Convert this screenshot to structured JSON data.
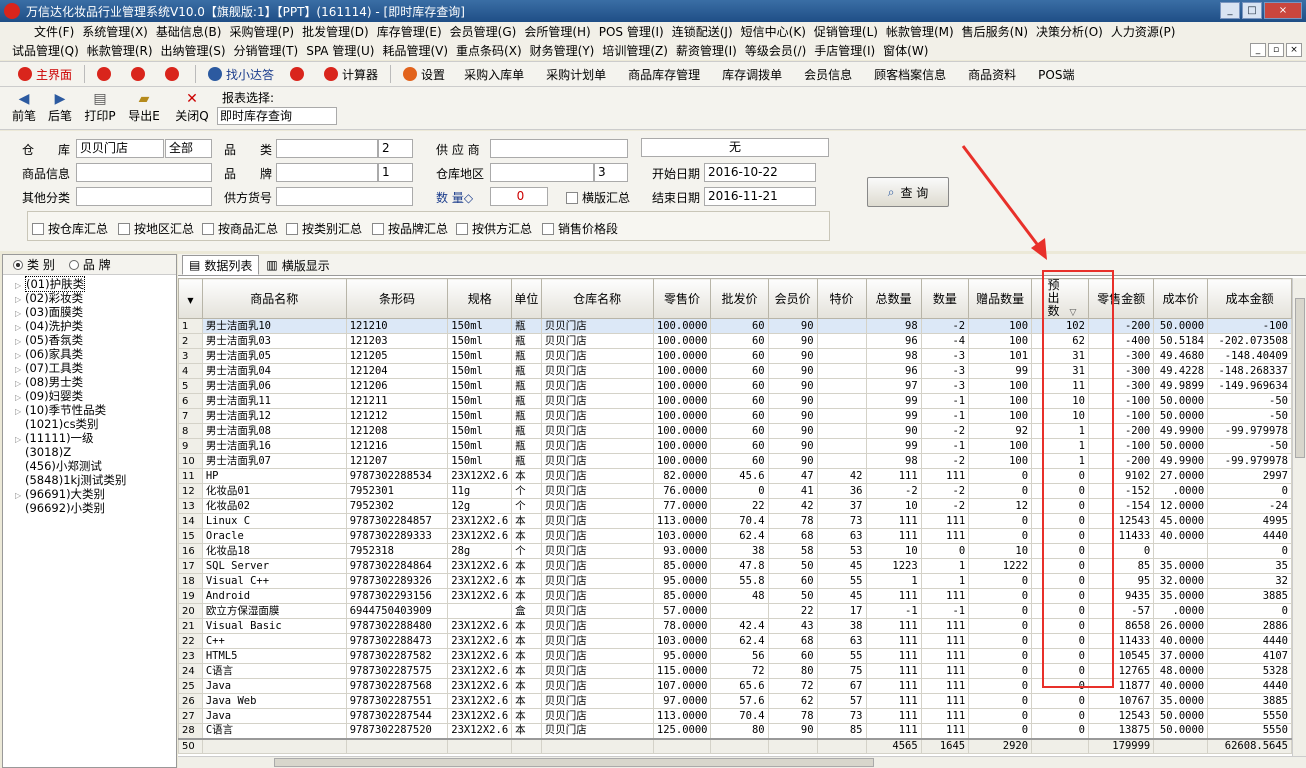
{
  "window": {
    "title": "万信达化妆品行业管理系统V10.0【旗舰版:1】【PPT】(161114) - [即时库存查询]",
    "minimize": "_",
    "restore": "□",
    "close": "×"
  },
  "menu1": [
    "文件(F)",
    "系统管理(X)",
    "基础信息(B)",
    "采购管理(P)",
    "批发管理(D)",
    "库存管理(E)",
    "会员管理(G)",
    "会所管理(H)",
    "POS 管理(I)",
    "连锁配送(J)",
    "短信中心(K)",
    "促销管理(L)",
    "帐款管理(M)",
    "售后服务(N)",
    "决策分析(O)",
    "人力资源(P)"
  ],
  "menu2": [
    "试品管理(Q)",
    "帐款管理(R)",
    "出纳管理(S)",
    "分销管理(T)",
    "SPA 管理(U)",
    "耗品管理(V)",
    "重点条码(X)",
    "财务管理(Y)",
    "培训管理(Z)",
    "薪资管理(I)",
    "等级会员(/)",
    "手店管理(I)",
    "窗体(W)"
  ],
  "toolbar": {
    "home": "主界面",
    "find": "找小达答",
    "calc": "计算器",
    "settings": "设置",
    "links": [
      "采购入库单",
      "采购计划单",
      "商品库存管理",
      "库存调拨单",
      "会员信息",
      "顾客档案信息",
      "商品资料",
      "POS端"
    ]
  },
  "actions": {
    "prev": "前笔",
    "next": "后笔",
    "print": "打印P",
    "export": "导出E",
    "close": "关闭Q",
    "report_label": "报表选择:",
    "report_value": "即时库存查询"
  },
  "filter": {
    "warehouse_label": "仓　　库",
    "warehouse_value": "贝贝门店",
    "warehouse_all": "全部",
    "category_label": "品　　类",
    "category_count": "2",
    "supplier_label": "供 应 商",
    "none_label": "无",
    "product_info_label": "商品信息",
    "brand_label": "品　　牌",
    "brand_count": "1",
    "area_label": "仓库地区",
    "area_count": "3",
    "start_date_label": "开始日期",
    "start_date": "2016-10-22",
    "other_cat_label": "其他分类",
    "supplier_code_label": "供方货号",
    "qty_label": "数 量◇",
    "qty_value": "0",
    "landscape_sum": "横版汇总",
    "end_date_label": "结束日期",
    "end_date": "2016-11-21",
    "query_button": "查 询",
    "sum_options": [
      "按仓库汇总",
      "按地区汇总",
      "按商品汇总",
      "按类别汇总",
      "按品牌汇总",
      "按供方汇总",
      "销售价格段"
    ]
  },
  "left_panel": {
    "tab_category": "类 别",
    "tab_brand": "品 牌",
    "tree": [
      {
        "label": "(01)护肤类",
        "exp": true,
        "selected": true
      },
      {
        "label": "(02)彩妆类",
        "exp": true
      },
      {
        "label": "(03)面膜类",
        "exp": true
      },
      {
        "label": "(04)洗护类",
        "exp": true
      },
      {
        "label": "(05)香氛类",
        "exp": true
      },
      {
        "label": "(06)家具类",
        "exp": true
      },
      {
        "label": "(07)工具类",
        "exp": true
      },
      {
        "label": "(08)男士类",
        "exp": true
      },
      {
        "label": "(09)妇婴类",
        "exp": true
      },
      {
        "label": "(10)季节性品类",
        "exp": true
      },
      {
        "label": "(1021)cs类别",
        "exp": false
      },
      {
        "label": "(11111)一级",
        "exp": true
      },
      {
        "label": "(3018)Z",
        "exp": false
      },
      {
        "label": "(456)小郑测试",
        "exp": false
      },
      {
        "label": "(5848)1kj测试类别",
        "exp": false
      },
      {
        "label": "(96691)大类别",
        "exp": true
      },
      {
        "label": "(96692)小类别",
        "exp": false
      }
    ]
  },
  "data_tabs": {
    "list": "数据列表",
    "landscape": "横版显示"
  },
  "table": {
    "columns": [
      "",
      "商品名称",
      "条形码",
      "规格",
      "单位",
      "仓库名称",
      "零售价",
      "批发价",
      "会员价",
      "特价",
      "总数量",
      "数量",
      "赠品数量",
      "预出数",
      "零售金额",
      "成本价",
      "成本金额"
    ],
    "rows": [
      [
        "1",
        "男士洁面乳10",
        "121210",
        "150ml",
        "瓶",
        "贝贝门店",
        "100.0000",
        "60",
        "90",
        "",
        "98",
        "-2",
        "100",
        "102",
        "-200",
        "50.0000",
        "-100"
      ],
      [
        "2",
        "男士洁面乳03",
        "121203",
        "150ml",
        "瓶",
        "贝贝门店",
        "100.0000",
        "60",
        "90",
        "",
        "96",
        "-4",
        "100",
        "62",
        "-400",
        "50.5184",
        "-202.073508"
      ],
      [
        "3",
        "男士洁面乳05",
        "121205",
        "150ml",
        "瓶",
        "贝贝门店",
        "100.0000",
        "60",
        "90",
        "",
        "98",
        "-3",
        "101",
        "31",
        "-300",
        "49.4680",
        "-148.40409"
      ],
      [
        "4",
        "男士洁面乳04",
        "121204",
        "150ml",
        "瓶",
        "贝贝门店",
        "100.0000",
        "60",
        "90",
        "",
        "96",
        "-3",
        "99",
        "31",
        "-300",
        "49.4228",
        "-148.268337"
      ],
      [
        "5",
        "男士洁面乳06",
        "121206",
        "150ml",
        "瓶",
        "贝贝门店",
        "100.0000",
        "60",
        "90",
        "",
        "97",
        "-3",
        "100",
        "11",
        "-300",
        "49.9899",
        "-149.969634"
      ],
      [
        "6",
        "男士洁面乳11",
        "121211",
        "150ml",
        "瓶",
        "贝贝门店",
        "100.0000",
        "60",
        "90",
        "",
        "99",
        "-1",
        "100",
        "10",
        "-100",
        "50.0000",
        "-50"
      ],
      [
        "7",
        "男士洁面乳12",
        "121212",
        "150ml",
        "瓶",
        "贝贝门店",
        "100.0000",
        "60",
        "90",
        "",
        "99",
        "-1",
        "100",
        "10",
        "-100",
        "50.0000",
        "-50"
      ],
      [
        "8",
        "男士洁面乳08",
        "121208",
        "150ml",
        "瓶",
        "贝贝门店",
        "100.0000",
        "60",
        "90",
        "",
        "90",
        "-2",
        "92",
        "1",
        "-200",
        "49.9900",
        "-99.979978"
      ],
      [
        "9",
        "男士洁面乳16",
        "121216",
        "150ml",
        "瓶",
        "贝贝门店",
        "100.0000",
        "60",
        "90",
        "",
        "99",
        "-1",
        "100",
        "1",
        "-100",
        "50.0000",
        "-50"
      ],
      [
        "10",
        "男士洁面乳07",
        "121207",
        "150ml",
        "瓶",
        "贝贝门店",
        "100.0000",
        "60",
        "90",
        "",
        "98",
        "-2",
        "100",
        "1",
        "-200",
        "49.9900",
        "-99.979978"
      ],
      [
        "11",
        "HP",
        "9787302288534",
        "23X12X2.6",
        "本",
        "贝贝门店",
        "82.0000",
        "45.6",
        "47",
        "42",
        "111",
        "111",
        "0",
        "0",
        "9102",
        "27.0000",
        "2997"
      ],
      [
        "12",
        "化妆品01",
        "7952301",
        "11g",
        "个",
        "贝贝门店",
        "76.0000",
        "0",
        "41",
        "36",
        "-2",
        "-2",
        "0",
        "0",
        "-152",
        ".0000",
        "0"
      ],
      [
        "13",
        "化妆品02",
        "7952302",
        "12g",
        "个",
        "贝贝门店",
        "77.0000",
        "22",
        "42",
        "37",
        "10",
        "-2",
        "12",
        "0",
        "-154",
        "12.0000",
        "-24"
      ],
      [
        "14",
        "Linux C",
        "9787302284857",
        "23X12X2.6",
        "本",
        "贝贝门店",
        "113.0000",
        "70.4",
        "78",
        "73",
        "111",
        "111",
        "0",
        "0",
        "12543",
        "45.0000",
        "4995"
      ],
      [
        "15",
        "Oracle",
        "9787302289333",
        "23X12X2.6",
        "本",
        "贝贝门店",
        "103.0000",
        "62.4",
        "68",
        "63",
        "111",
        "111",
        "0",
        "0",
        "11433",
        "40.0000",
        "4440"
      ],
      [
        "16",
        "化妆品18",
        "7952318",
        "28g",
        "个",
        "贝贝门店",
        "93.0000",
        "38",
        "58",
        "53",
        "10",
        "0",
        "10",
        "0",
        "0",
        "",
        "0"
      ],
      [
        "17",
        "SQL Server",
        "9787302284864",
        "23X12X2.6",
        "本",
        "贝贝门店",
        "85.0000",
        "47.8",
        "50",
        "45",
        "1223",
        "1",
        "1222",
        "0",
        "85",
        "35.0000",
        "35"
      ],
      [
        "18",
        "Visual C++",
        "9787302289326",
        "23X12X2.6",
        "本",
        "贝贝门店",
        "95.0000",
        "55.8",
        "60",
        "55",
        "1",
        "1",
        "0",
        "0",
        "95",
        "32.0000",
        "32"
      ],
      [
        "19",
        "Android",
        "9787302293156",
        "23X12X2.6",
        "本",
        "贝贝门店",
        "85.0000",
        "48",
        "50",
        "45",
        "111",
        "111",
        "0",
        "0",
        "9435",
        "35.0000",
        "3885"
      ],
      [
        "20",
        "欧立方保湿面膜",
        "6944750403909",
        "",
        "盒",
        "贝贝门店",
        "57.0000",
        "",
        "22",
        "17",
        "-1",
        "-1",
        "0",
        "0",
        "-57",
        ".0000",
        "0"
      ],
      [
        "21",
        "Visual Basic",
        "9787302288480",
        "23X12X2.6",
        "本",
        "贝贝门店",
        "78.0000",
        "42.4",
        "43",
        "38",
        "111",
        "111",
        "0",
        "0",
        "8658",
        "26.0000",
        "2886"
      ],
      [
        "22",
        "C++",
        "9787302288473",
        "23X12X2.6",
        "本",
        "贝贝门店",
        "103.0000",
        "62.4",
        "68",
        "63",
        "111",
        "111",
        "0",
        "0",
        "11433",
        "40.0000",
        "4440"
      ],
      [
        "23",
        "HTML5",
        "9787302287582",
        "23X12X2.6",
        "本",
        "贝贝门店",
        "95.0000",
        "56",
        "60",
        "55",
        "111",
        "111",
        "0",
        "0",
        "10545",
        "37.0000",
        "4107"
      ],
      [
        "24",
        "C语言",
        "9787302287575",
        "23X12X2.6",
        "本",
        "贝贝门店",
        "115.0000",
        "72",
        "80",
        "75",
        "111",
        "111",
        "0",
        "0",
        "12765",
        "48.0000",
        "5328"
      ],
      [
        "25",
        "Java",
        "9787302287568",
        "23X12X2.6",
        "本",
        "贝贝门店",
        "107.0000",
        "65.6",
        "72",
        "67",
        "111",
        "111",
        "0",
        "0",
        "11877",
        "40.0000",
        "4440"
      ],
      [
        "26",
        "Java Web",
        "9787302287551",
        "23X12X2.6",
        "本",
        "贝贝门店",
        "97.0000",
        "57.6",
        "62",
        "57",
        "111",
        "111",
        "0",
        "0",
        "10767",
        "35.0000",
        "3885"
      ],
      [
        "27",
        "Java",
        "9787302287544",
        "23X12X2.6",
        "本",
        "贝贝门店",
        "113.0000",
        "70.4",
        "78",
        "73",
        "111",
        "111",
        "0",
        "0",
        "12543",
        "50.0000",
        "5550"
      ],
      [
        "28",
        "C语言",
        "9787302287520",
        "23X12X2.6",
        "本",
        "贝贝门店",
        "125.0000",
        "80",
        "90",
        "85",
        "111",
        "111",
        "0",
        "0",
        "13875",
        "50.0000",
        "5550"
      ]
    ],
    "footer": [
      "50",
      "",
      "",
      "",
      "",
      "",
      "",
      "",
      "",
      "",
      "4565",
      "1645",
      "2920",
      "",
      "179999",
      "",
      "62608.5645"
    ]
  },
  "colors": {
    "highlight": "#e8302a",
    "selected_row": "#dce8f7"
  }
}
